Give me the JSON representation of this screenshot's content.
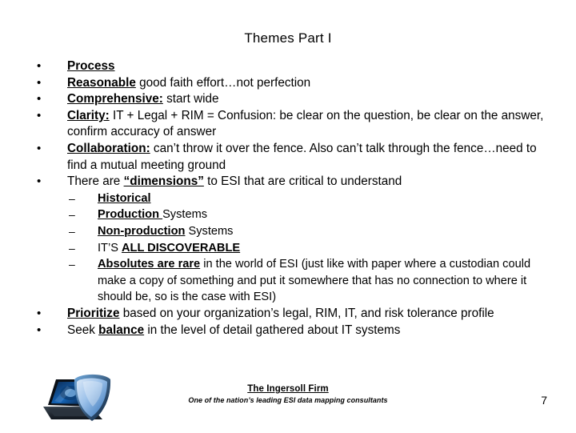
{
  "slide": {
    "title": "Themes Part I",
    "page_number": "7"
  },
  "bullets": [
    {
      "level": 1,
      "marker": "•",
      "segments": [
        {
          "text": "Process",
          "emphasis": true
        }
      ]
    },
    {
      "level": 1,
      "marker": "•",
      "segments": [
        {
          "text": "Reasonable",
          "emphasis": true
        },
        {
          "text": " good faith effort…not perfection",
          "emphasis": false
        }
      ]
    },
    {
      "level": 1,
      "marker": "•",
      "segments": [
        {
          "text": "Comprehensive:",
          "emphasis": true
        },
        {
          "text": "  start wide",
          "emphasis": false
        }
      ]
    },
    {
      "level": 1,
      "marker": "•",
      "segments": [
        {
          "text": "Clarity:",
          "emphasis": true
        },
        {
          "text": "  IT + Legal + RIM = Confusion:  be clear on the question, be clear on the answer, confirm accuracy of answer",
          "emphasis": false
        }
      ]
    },
    {
      "level": 1,
      "marker": "•",
      "segments": [
        {
          "text": "Collaboration:",
          "emphasis": true
        },
        {
          "text": "  can’t throw it over the fence.  Also can’t talk through the fence…need to find a mutual meeting ground",
          "emphasis": false
        }
      ]
    },
    {
      "level": 1,
      "marker": "•",
      "segments": [
        {
          "text": "There are ",
          "emphasis": false
        },
        {
          "text": "“dimensions”",
          "emphasis": true
        },
        {
          "text": " to ESI that are critical to understand",
          "emphasis": false
        }
      ]
    },
    {
      "level": 2,
      "marker": "–",
      "segments": [
        {
          "text": "Historical",
          "emphasis": true
        }
      ]
    },
    {
      "level": 2,
      "marker": "–",
      "segments": [
        {
          "text": "Production ",
          "emphasis": true
        },
        {
          "text": "Systems",
          "emphasis": false
        }
      ]
    },
    {
      "level": 2,
      "marker": "–",
      "segments": [
        {
          "text": "Non-production",
          "emphasis": true
        },
        {
          "text": " Systems",
          "emphasis": false
        }
      ]
    },
    {
      "level": 2,
      "marker": "–",
      "segments": [
        {
          "text": "IT’S ",
          "emphasis": false
        },
        {
          "text": "ALL DISCOVERABLE",
          "emphasis": true
        }
      ]
    },
    {
      "level": 2,
      "marker": "–",
      "segments": [
        {
          "text": "Absolutes are rare",
          "emphasis": true
        },
        {
          "text": " in the world of ESI (just like with paper where a custodian could make a copy of something and put it somewhere that has no connection to where it should be, so is the case with ESI)",
          "emphasis": false
        }
      ]
    },
    {
      "level": 1,
      "marker": "•",
      "segments": [
        {
          "text": "Prioritize",
          "emphasis": true
        },
        {
          "text": " based on your organization’s legal, RIM, IT, and risk tolerance profile",
          "emphasis": false
        }
      ]
    },
    {
      "level": 1,
      "marker": "•",
      "segments": [
        {
          "text": "Seek ",
          "emphasis": false
        },
        {
          "text": "balance",
          "emphasis": true
        },
        {
          "text": " in the level of detail gathered about IT systems",
          "emphasis": false
        }
      ]
    }
  ],
  "footer": {
    "firm_name": "The Ingersoll Firm",
    "tagline": "One of the nation’s leading ESI data mapping consultants",
    "logo_name": "laptop-shield-logo"
  },
  "colors": {
    "background": "#ffffff",
    "text": "#000000",
    "logo_shield_light": "#bcd6f2",
    "logo_shield_mid": "#4a8fd4",
    "logo_shield_dark": "#0c2340",
    "logo_screen_blue": "#1565b8"
  }
}
